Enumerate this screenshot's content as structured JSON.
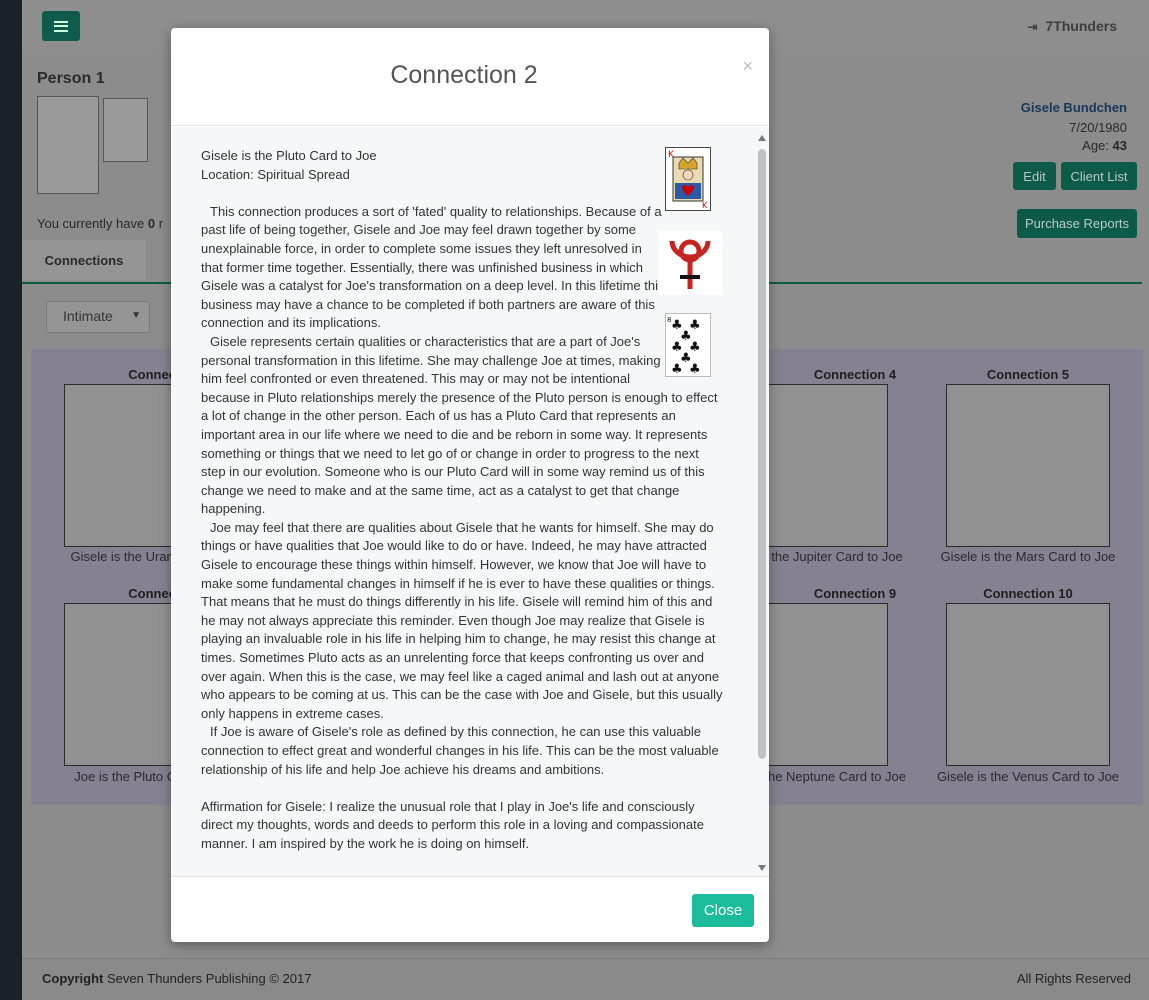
{
  "app": {
    "user_name": "7Thunders",
    "signout_icon": "sign-out-icon"
  },
  "person": {
    "title": "Person 1",
    "client_name": "Gisele Bundchen",
    "dob": "7/20/1980",
    "age_label": "Age:",
    "age_value": "43",
    "edit_label": "Edit",
    "client_list_label": "Client List",
    "credits_prefix": "You currently have",
    "credits_value": "0",
    "credits_suffix": "r",
    "purchase_label": "Purchase Reports"
  },
  "tabs": {
    "connections": "Connections"
  },
  "filter": {
    "selected": "Intimate"
  },
  "grid": {
    "cells": [
      {
        "title": "Connection",
        "caption": "Gisele is the Uranus"
      },
      {
        "title": "Connection 4",
        "caption": "the Jupiter Card to Joe"
      },
      {
        "title": "Connection 5",
        "caption": "Gisele is the Mars Card to Joe"
      },
      {
        "title": "Connection",
        "caption": "Joe is the Pluto Car"
      },
      {
        "title": "Connection 9",
        "caption": "he Neptune Card to Joe"
      },
      {
        "title": "Connection 10",
        "caption": "Gisele is the Venus Card to Joe"
      }
    ]
  },
  "footer": {
    "copyright_bold": "Copyright",
    "copyright_text": "Seven Thunders Publishing © 2017",
    "rights": "All Rights Reserved"
  },
  "modal": {
    "title": "Connection 2",
    "close_x": "×",
    "close_label": "Close",
    "accent": "#1bbc9b",
    "line1": "Gisele is the Pluto Card to Joe",
    "line2": "Location: Spiritual Spread",
    "para1": "This connection produces a sort of 'fated' quality to relationships. Because of a past life of being together, Gisele and Joe may feel drawn together by some unexplainable force, in order to complete some issues they left unresolved in that former time together. Essentially, there was unfinished business in which Gisele was a catalyst for Joe's transformation on a deep level. In this lifetime this business may have a chance to be completed if both partners are aware of this connection and its implications.",
    "para2": "Gisele represents certain qualities or characteristics that are a part of Joe's personal transformation in this lifetime. She may challenge Joe at times, making him feel confronted or even threatened. This may or may not be intentional because in Pluto relationships merely the presence of the Pluto person is enough to effect a lot of change in the other person. Each of us has a Pluto Card that represents an important area in our life where we need to die and be reborn in some way. It represents something or things that we need to let go of or change in order to progress to the next step in our evolution. Someone who is our Pluto Card will in some way remind us of this change we need to make and at the same time, act as a catalyst to get that change happening.",
    "para3": "Joe may feel that there are qualities about Gisele that he wants for himself. She may do things or have qualities that Joe would like to do or have. Indeed, he may have attracted Gisele to encourage these things within himself. However, we know that Joe will have to make some fundamental changes in himself if he is ever to have these qualities or things. That means that he must do things differently in his life. Gisele will remind him of this and he may not always appreciate this reminder. Even though Joe may realize that Gisele is playing an invaluable role in his life in helping him to change, he may resist this change at times. Sometimes Pluto acts as an unrelenting force that keeps confronting us over and over again. When this is the case, we may feel like a caged animal and lash out at anyone who appears to be coming at us. This can be the case with Joe and Gisele, but this usually only happens in extreme cases.",
    "para4": "If Joe is aware of Gisele's role as defined by this connection, he can use this valuable connection to effect great and wonderful changes in his life. This can be the most valuable relationship of his life and help Joe achieve his dreams and ambitions.",
    "affirmation": "Affirmation for Gisele: I realize the unusual role that I play in Joe's life and consciously direct my thoughts, words and deeds to perform this role in a loving and compassionate manner. I am inspired by the work he is doing on himself.",
    "card_king_label": "K",
    "card_eight_label": "8"
  }
}
